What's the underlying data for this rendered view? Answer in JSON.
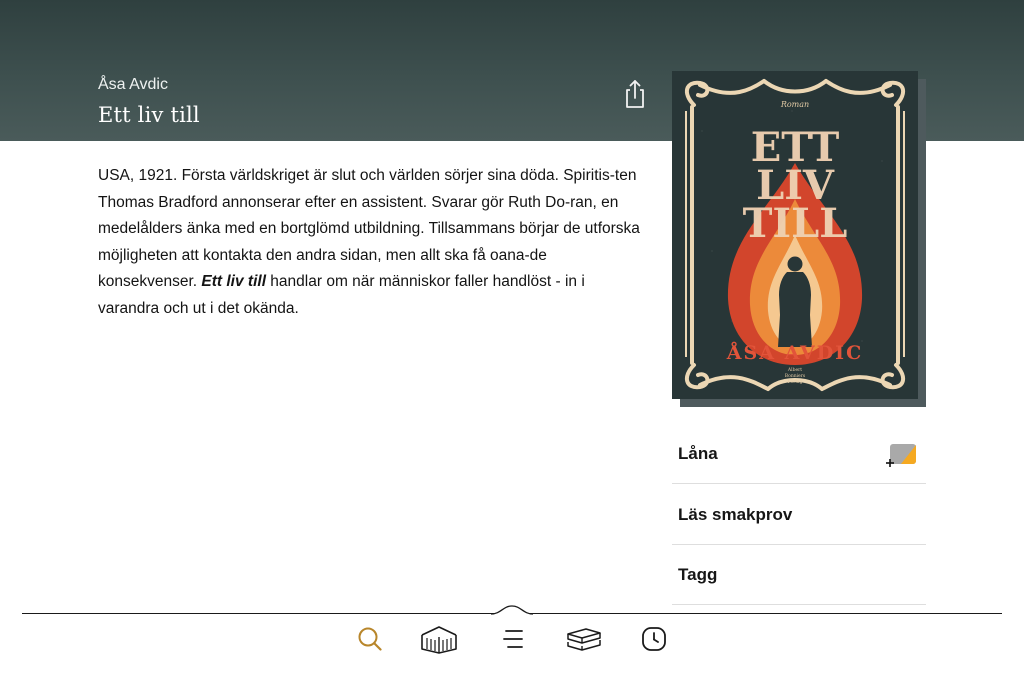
{
  "header": {
    "author": "Åsa Avdic",
    "title": "Ett liv till",
    "share_icon": "share-icon"
  },
  "description": {
    "text_before": "USA, 1921. Första världskriget är slut och världen sörjer sina döda. Spiritis-ten Thomas Bradford annonserar efter en assistent. Svarar gör Ruth Do-ran, en medelålders änka med en bortglömd utbildning. Tillsammans börjar de utforska möjligheten att kontakta den andra sidan, men allt ska få oana-de konsekvenser. ",
    "title_italic": "Ett liv till",
    "text_after": " handlar om när människor faller handlöst - in i varandra och ut i det okända."
  },
  "cover": {
    "series_label": "Roman",
    "title_lines": [
      "ETT",
      "LIV",
      "TILL"
    ],
    "author": "ÅSA AVDIC",
    "publisher_lines": [
      "Albert",
      "Bonniers",
      "Förlag"
    ],
    "colors": {
      "background": "#283637",
      "frame": "#ecd7b4",
      "title": "#efd1b2",
      "author": "#e2543a",
      "flame_outer": "#d2452c",
      "flame_mid": "#ec8a3a",
      "flame_inner": "#f5c890"
    }
  },
  "actions": [
    {
      "label": "Låna",
      "icon": "loan-add-icon"
    },
    {
      "label": "Läs smakprov"
    },
    {
      "label": "Tagg"
    }
  ],
  "tabbar": {
    "tabs": [
      {
        "name": "search",
        "icon": "search-icon",
        "active": true
      },
      {
        "name": "library",
        "icon": "library-icon",
        "active": false
      },
      {
        "name": "menu",
        "icon": "menu-icon",
        "active": false
      },
      {
        "name": "bookshelf",
        "icon": "books-icon",
        "active": false
      },
      {
        "name": "history",
        "icon": "clock-icon",
        "active": false
      }
    ],
    "active_color": "#b8862b",
    "inactive_color": "#1a1a1a"
  }
}
